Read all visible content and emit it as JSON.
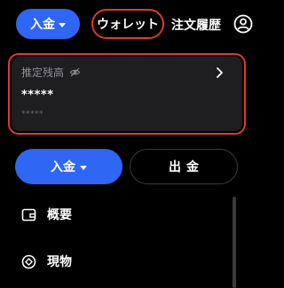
{
  "nav": {
    "deposit_label": "入金",
    "wallet_label": "ウォレット",
    "orders_label": "注文履歴",
    "account_icon": "user-circle-icon",
    "highlight_color": "#e23a22",
    "accent_color": "#2f66f3"
  },
  "balance_card": {
    "label": "推定残高",
    "visibility_icon": "eye-off-icon",
    "value": "*****",
    "sub_value": "*****",
    "detail_icon": "chevron-right-icon"
  },
  "actions": {
    "deposit_label": "入金",
    "withdraw_label": "出金"
  },
  "menu": {
    "items": [
      {
        "label": "概要",
        "icon": "wallet-icon"
      },
      {
        "label": "現物",
        "icon": "spot-coin-icon"
      }
    ]
  }
}
